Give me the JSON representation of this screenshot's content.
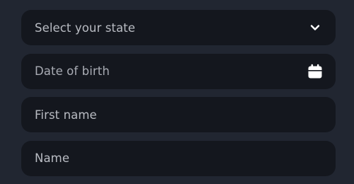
{
  "form": {
    "state": {
      "placeholder": "Select your state",
      "icon": "chevron-down-icon"
    },
    "dob": {
      "placeholder": "Date of birth",
      "icon": "calendar-icon"
    },
    "first_name": {
      "placeholder": "First name"
    },
    "name": {
      "placeholder": "Name"
    }
  },
  "colors": {
    "background": "#212631",
    "field_background": "#14171e",
    "placeholder_text": "#b9bcc3",
    "icon": "#ffffff"
  }
}
